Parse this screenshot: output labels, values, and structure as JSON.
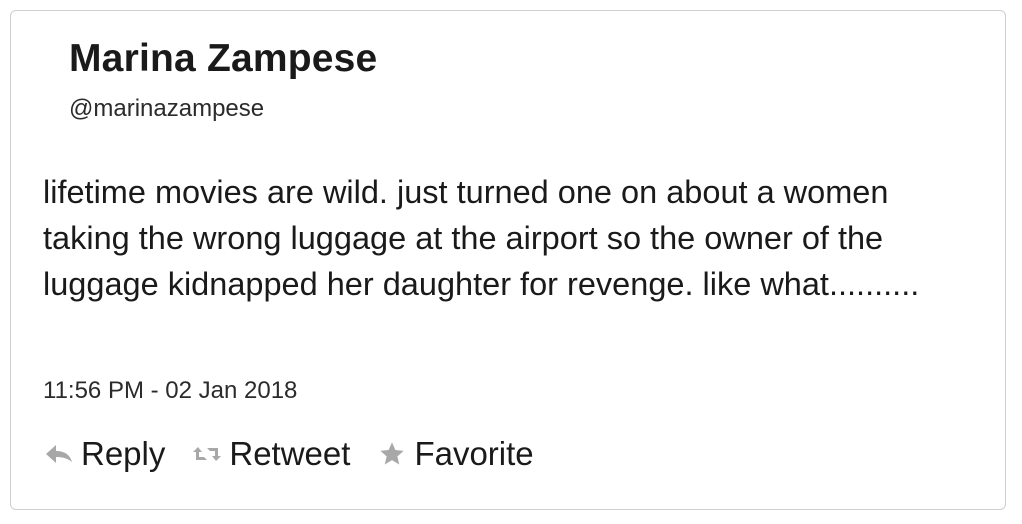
{
  "tweet": {
    "author_name": "Marina Zampese",
    "author_handle": "@marinazampese",
    "text": "lifetime movies are wild. just turned one on about a women taking the wrong luggage at the airport so the owner of the luggage kidnapped her daughter for revenge. like what..........",
    "timestamp": "11:56 PM - 02 Jan 2018"
  },
  "actions": {
    "reply_label": "Reply",
    "reply_icon": "reply-arrow-icon",
    "retweet_label": "Retweet",
    "retweet_icon": "retweet-icon",
    "favorite_label": "Favorite",
    "favorite_icon": "star-icon",
    "icon_color": "#a8a8a8"
  }
}
